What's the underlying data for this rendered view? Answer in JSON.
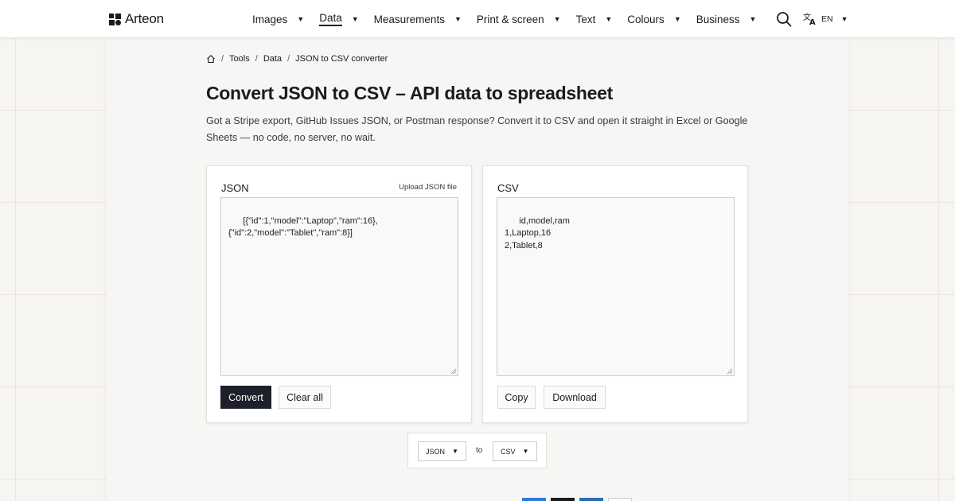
{
  "header": {
    "brand": "Arteon",
    "nav": [
      {
        "label": "Images"
      },
      {
        "label": "Data",
        "active": true
      },
      {
        "label": "Measurements"
      },
      {
        "label": "Print & screen"
      },
      {
        "label": "Text"
      },
      {
        "label": "Colours"
      },
      {
        "label": "Business"
      }
    ],
    "language": "EN",
    "icons": {
      "search": "search-icon",
      "translate": "translate-icon",
      "caret": "caret-down-icon"
    }
  },
  "breadcrumb": {
    "home_icon": "home-icon",
    "items": [
      "Tools",
      "Data",
      "JSON to CSV converter"
    ]
  },
  "page": {
    "title": "Convert JSON to CSV – API data to spreadsheet",
    "intro": "Got a Stripe export, GitHub Issues JSON, or Postman response? Convert it to CSV and open it straight in Excel or Google Sheets — no code, no server, no wait."
  },
  "json_panel": {
    "label": "JSON",
    "upload_link": "Upload JSON file",
    "value": "[{\"id\":1,\"model\":\"Laptop\",\"ram\":16},\n{\"id\":2,\"model\":\"Tablet\",\"ram\":8}]",
    "convert_label": "Convert",
    "clear_label": "Clear all"
  },
  "csv_panel": {
    "label": "CSV",
    "value": "id,model,ram\n1,Laptop,16\n2,Tablet,8",
    "copy_label": "Copy",
    "download_label": "Download"
  },
  "format_switch": {
    "from": "JSON",
    "connector": "to",
    "to": "CSV"
  },
  "colors": {
    "primary_button": "#1d1f2b",
    "swatches": [
      "#2f7bd6",
      "#1b1b1f",
      "#2a6db5",
      "#ffffff"
    ]
  }
}
